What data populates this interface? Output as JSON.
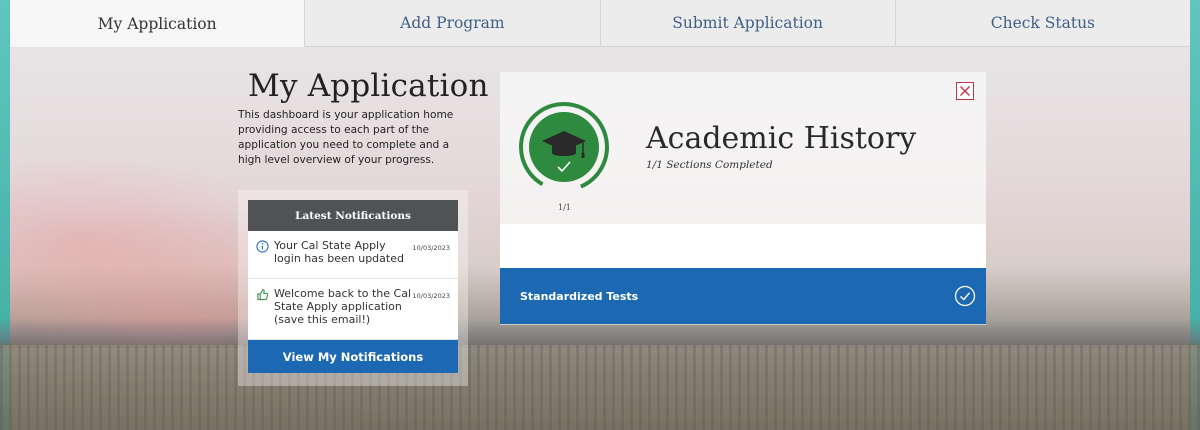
{
  "tabs": [
    {
      "label": "My Application",
      "active": true
    },
    {
      "label": "Add Program",
      "active": false
    },
    {
      "label": "Submit Application",
      "active": false
    },
    {
      "label": "Check Status",
      "active": false
    }
  ],
  "intro": {
    "title": "My Application",
    "description": "This dashboard is your application home providing access to each part of the application you need to complete and a high level overview of your progress."
  },
  "notifications": {
    "header": "Latest Notifications",
    "items": [
      {
        "icon": "info-circle-icon",
        "text": "Your Cal State Apply login has been updated",
        "date": "10/03/2023"
      },
      {
        "icon": "thumbs-up-icon",
        "text": "Welcome back to the Cal State Apply application (save this email!)",
        "date": "10/03/2023"
      }
    ],
    "button_label": "View My Notifications"
  },
  "card": {
    "title": "Academic History",
    "subtitle": "1/1 Sections Completed",
    "progress_label": "1/1",
    "progress_fraction": 1.0,
    "icon": "graduation-cap-icon",
    "close_icon": "close-icon",
    "sections": [
      {
        "label": "Standardized Tests",
        "status": "complete",
        "icon": "check-circle-icon"
      }
    ]
  },
  "colors": {
    "accent_blue": "#1d68b3",
    "progress_green": "#2e8a3f",
    "close_red": "#c0334a",
    "notif_header": "#4f5356",
    "tab_text": "#3f5f86"
  }
}
